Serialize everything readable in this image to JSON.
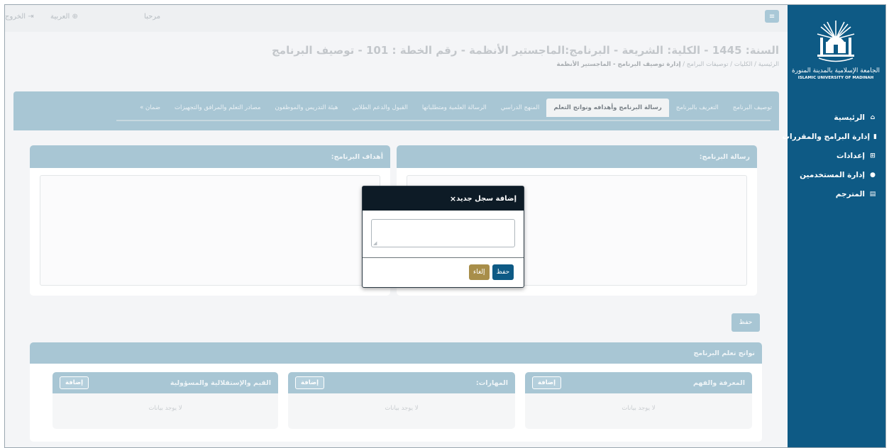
{
  "topbar": {
    "menu_icon": "menu-icon",
    "welcome": "مرحبا",
    "language": "العربية",
    "logout": "الخروج"
  },
  "sidebar": {
    "logo_ar": "الجامعة الإسلامية بالمدينة المنورة",
    "logo_en": "ISLAMIC UNIVERSITY OF MADINAH",
    "items": [
      {
        "label": "الرئيسية",
        "icon": "home-icon"
      },
      {
        "label": "إدارة البرامج والمقررات",
        "icon": "book-icon"
      },
      {
        "label": "إعدادات",
        "icon": "grid-icon"
      },
      {
        "label": "إدارة المستخدمين",
        "icon": "users-icon"
      },
      {
        "label": "المترجم",
        "icon": "translate-icon"
      }
    ]
  },
  "page": {
    "title": "السنة: 1445 - الكلية: الشريعة - البرنامج:الماجستير الأنظمة - رقم الخطة : 101 - توصيف البرنامج",
    "breadcrumb": {
      "home": "الرئيسية",
      "colleges": "الكليات",
      "specs": "توصيفات البرامج",
      "current": "إدارة توصيف البرنامج - الماجستير الأنظمة",
      "sep": "/"
    }
  },
  "tabs": [
    {
      "label": "توصيف البرنامج"
    },
    {
      "label": "التعريف بالبرنامج"
    },
    {
      "label": "رسالة البرنامج وأهدافه ونواتج التعلم",
      "active": true
    },
    {
      "label": "المنهج الدراسي"
    },
    {
      "label": "الرسالة العلمية ومتطلباتها"
    },
    {
      "label": "القبول والدعم الطلابي"
    },
    {
      "label": "هيئة التدريس والموظفون"
    },
    {
      "label": "مصادر التعلم والمرافق والتجهيزات"
    },
    {
      "label": "ضمان »"
    }
  ],
  "cards": {
    "mission": "رسالة البرنامج:",
    "goals": "أهداف البرنامج:",
    "save": "حفظ"
  },
  "outcomes": {
    "title": "نواتج تعلم البرنامج",
    "sections": [
      {
        "title": "المعرفة والفهم",
        "add": "إضافة",
        "empty": "لا يوجد بيانات"
      },
      {
        "title": "المهارات:",
        "add": "إضافة",
        "empty": "لا يوجد بيانات"
      },
      {
        "title": "القيم والإستقلالية والمسؤولية",
        "add": "إضافة",
        "empty": "لا يوجد بيانات"
      }
    ]
  },
  "modal": {
    "title": "إضافة سجل جديد",
    "close": "×",
    "textarea_value": "",
    "cancel": "إلغاء",
    "save": "حفظ"
  },
  "colors": {
    "sidebar": "#0e5a85",
    "modal_header": "#0d1b26",
    "cancel": "#a88e4a",
    "save": "#0e5a85",
    "panel": "#a8c6d4"
  }
}
